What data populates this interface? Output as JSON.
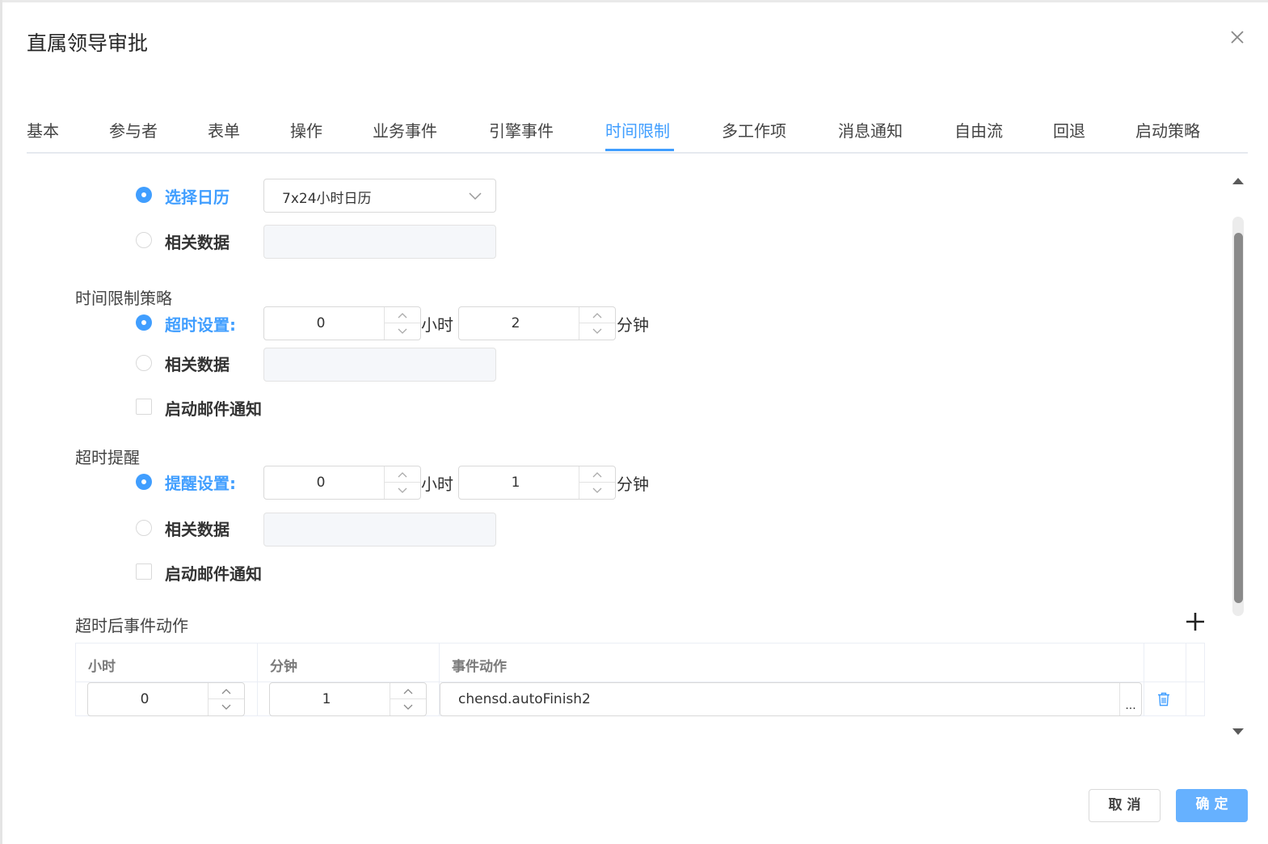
{
  "dialog": {
    "title": "直属领导审批",
    "tabs": [
      "基本",
      "参与者",
      "表单",
      "操作",
      "业务事件",
      "引擎事件",
      "时间限制",
      "多工作项",
      "消息通知",
      "自由流",
      "回退",
      "启动策略"
    ],
    "active_tab": "时间限制"
  },
  "calendar": {
    "option_calendar": "选择日历",
    "calendar_value": "7x24小时日历",
    "option_related": "相关数据"
  },
  "time_limit": {
    "section": "时间限制策略",
    "option_timeout": "超时设置:",
    "hours": "0",
    "hours_unit": "小时",
    "minutes": "2",
    "minutes_unit": "分钟",
    "option_related": "相关数据",
    "email_notify": "启动邮件通知"
  },
  "reminder": {
    "section": "超时提醒",
    "option_reminder": "提醒设置:",
    "hours": "0",
    "hours_unit": "小时",
    "minutes": "1",
    "minutes_unit": "分钟",
    "option_related": "相关数据",
    "email_notify": "启动邮件通知"
  },
  "events": {
    "section": "超时后事件动作",
    "columns": [
      "小时",
      "分钟",
      "事件动作"
    ],
    "rows": [
      {
        "hours": "0",
        "minutes": "1",
        "action": "chensd.autoFinish2",
        "picker": "..."
      }
    ]
  },
  "footer": {
    "cancel": "取 消",
    "ok": "确 定"
  },
  "colors": {
    "primary": "#409eff",
    "primary_light": "#66b1ff"
  }
}
